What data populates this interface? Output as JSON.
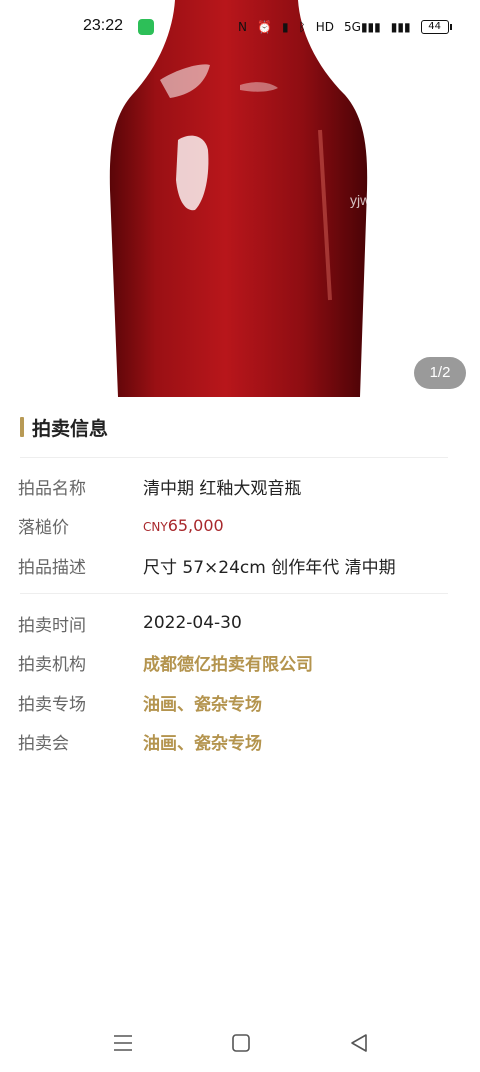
{
  "status_bar": {
    "time": "23:22",
    "icons": [
      "nfc-icon",
      "alarm-icon",
      "vibrate-icon",
      "bluetooth-icon",
      "hd-icon",
      "signal-5g-icon",
      "signal-5g-icon"
    ],
    "network_label": "5G",
    "hd_label": "HD",
    "battery": "44"
  },
  "gallery": {
    "watermark": "yjwh.shop",
    "counter": "1/2"
  },
  "section": {
    "title": "拍卖信息"
  },
  "details": {
    "name_label": "拍品名称",
    "name_value": "清中期 红釉大观音瓶",
    "price_label": "落槌价",
    "price_currency": "CNY",
    "price_amount": "65,000",
    "desc_label": "拍品描述",
    "desc_value": "尺寸 57×24cm 创作年代 清中期",
    "date_label": "拍卖时间",
    "date_value": "2022-04-30",
    "org_label": "拍卖机构",
    "org_value": "成都德亿拍卖有限公司",
    "session_label": "拍卖专场",
    "session_value": "油画、瓷杂专场",
    "auction_label": "拍卖会",
    "auction_value": "油画、瓷杂专场"
  },
  "colors": {
    "accent": "#b89a55",
    "price": "#a8282c",
    "vase": "#a31217"
  }
}
